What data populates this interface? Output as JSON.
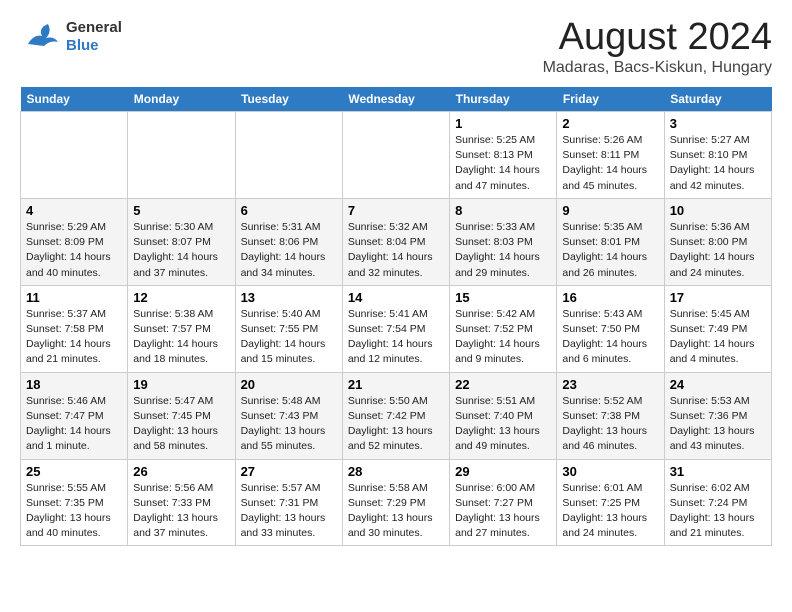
{
  "logo": {
    "line1": "General",
    "line2": "Blue"
  },
  "title": "August 2024",
  "subtitle": "Madaras, Bacs-Kiskun, Hungary",
  "days": [
    "Sunday",
    "Monday",
    "Tuesday",
    "Wednesday",
    "Thursday",
    "Friday",
    "Saturday"
  ],
  "weeks": [
    [
      {
        "date": "",
        "text": ""
      },
      {
        "date": "",
        "text": ""
      },
      {
        "date": "",
        "text": ""
      },
      {
        "date": "",
        "text": ""
      },
      {
        "date": "1",
        "text": "Sunrise: 5:25 AM\nSunset: 8:13 PM\nDaylight: 14 hours\nand 47 minutes."
      },
      {
        "date": "2",
        "text": "Sunrise: 5:26 AM\nSunset: 8:11 PM\nDaylight: 14 hours\nand 45 minutes."
      },
      {
        "date": "3",
        "text": "Sunrise: 5:27 AM\nSunset: 8:10 PM\nDaylight: 14 hours\nand 42 minutes."
      }
    ],
    [
      {
        "date": "4",
        "text": "Sunrise: 5:29 AM\nSunset: 8:09 PM\nDaylight: 14 hours\nand 40 minutes."
      },
      {
        "date": "5",
        "text": "Sunrise: 5:30 AM\nSunset: 8:07 PM\nDaylight: 14 hours\nand 37 minutes."
      },
      {
        "date": "6",
        "text": "Sunrise: 5:31 AM\nSunset: 8:06 PM\nDaylight: 14 hours\nand 34 minutes."
      },
      {
        "date": "7",
        "text": "Sunrise: 5:32 AM\nSunset: 8:04 PM\nDaylight: 14 hours\nand 32 minutes."
      },
      {
        "date": "8",
        "text": "Sunrise: 5:33 AM\nSunset: 8:03 PM\nDaylight: 14 hours\nand 29 minutes."
      },
      {
        "date": "9",
        "text": "Sunrise: 5:35 AM\nSunset: 8:01 PM\nDaylight: 14 hours\nand 26 minutes."
      },
      {
        "date": "10",
        "text": "Sunrise: 5:36 AM\nSunset: 8:00 PM\nDaylight: 14 hours\nand 24 minutes."
      }
    ],
    [
      {
        "date": "11",
        "text": "Sunrise: 5:37 AM\nSunset: 7:58 PM\nDaylight: 14 hours\nand 21 minutes."
      },
      {
        "date": "12",
        "text": "Sunrise: 5:38 AM\nSunset: 7:57 PM\nDaylight: 14 hours\nand 18 minutes."
      },
      {
        "date": "13",
        "text": "Sunrise: 5:40 AM\nSunset: 7:55 PM\nDaylight: 14 hours\nand 15 minutes."
      },
      {
        "date": "14",
        "text": "Sunrise: 5:41 AM\nSunset: 7:54 PM\nDaylight: 14 hours\nand 12 minutes."
      },
      {
        "date": "15",
        "text": "Sunrise: 5:42 AM\nSunset: 7:52 PM\nDaylight: 14 hours\nand 9 minutes."
      },
      {
        "date": "16",
        "text": "Sunrise: 5:43 AM\nSunset: 7:50 PM\nDaylight: 14 hours\nand 6 minutes."
      },
      {
        "date": "17",
        "text": "Sunrise: 5:45 AM\nSunset: 7:49 PM\nDaylight: 14 hours\nand 4 minutes."
      }
    ],
    [
      {
        "date": "18",
        "text": "Sunrise: 5:46 AM\nSunset: 7:47 PM\nDaylight: 14 hours\nand 1 minute."
      },
      {
        "date": "19",
        "text": "Sunrise: 5:47 AM\nSunset: 7:45 PM\nDaylight: 13 hours\nand 58 minutes."
      },
      {
        "date": "20",
        "text": "Sunrise: 5:48 AM\nSunset: 7:43 PM\nDaylight: 13 hours\nand 55 minutes."
      },
      {
        "date": "21",
        "text": "Sunrise: 5:50 AM\nSunset: 7:42 PM\nDaylight: 13 hours\nand 52 minutes."
      },
      {
        "date": "22",
        "text": "Sunrise: 5:51 AM\nSunset: 7:40 PM\nDaylight: 13 hours\nand 49 minutes."
      },
      {
        "date": "23",
        "text": "Sunrise: 5:52 AM\nSunset: 7:38 PM\nDaylight: 13 hours\nand 46 minutes."
      },
      {
        "date": "24",
        "text": "Sunrise: 5:53 AM\nSunset: 7:36 PM\nDaylight: 13 hours\nand 43 minutes."
      }
    ],
    [
      {
        "date": "25",
        "text": "Sunrise: 5:55 AM\nSunset: 7:35 PM\nDaylight: 13 hours\nand 40 minutes."
      },
      {
        "date": "26",
        "text": "Sunrise: 5:56 AM\nSunset: 7:33 PM\nDaylight: 13 hours\nand 37 minutes."
      },
      {
        "date": "27",
        "text": "Sunrise: 5:57 AM\nSunset: 7:31 PM\nDaylight: 13 hours\nand 33 minutes."
      },
      {
        "date": "28",
        "text": "Sunrise: 5:58 AM\nSunset: 7:29 PM\nDaylight: 13 hours\nand 30 minutes."
      },
      {
        "date": "29",
        "text": "Sunrise: 6:00 AM\nSunset: 7:27 PM\nDaylight: 13 hours\nand 27 minutes."
      },
      {
        "date": "30",
        "text": "Sunrise: 6:01 AM\nSunset: 7:25 PM\nDaylight: 13 hours\nand 24 minutes."
      },
      {
        "date": "31",
        "text": "Sunrise: 6:02 AM\nSunset: 7:24 PM\nDaylight: 13 hours\nand 21 minutes."
      }
    ]
  ]
}
